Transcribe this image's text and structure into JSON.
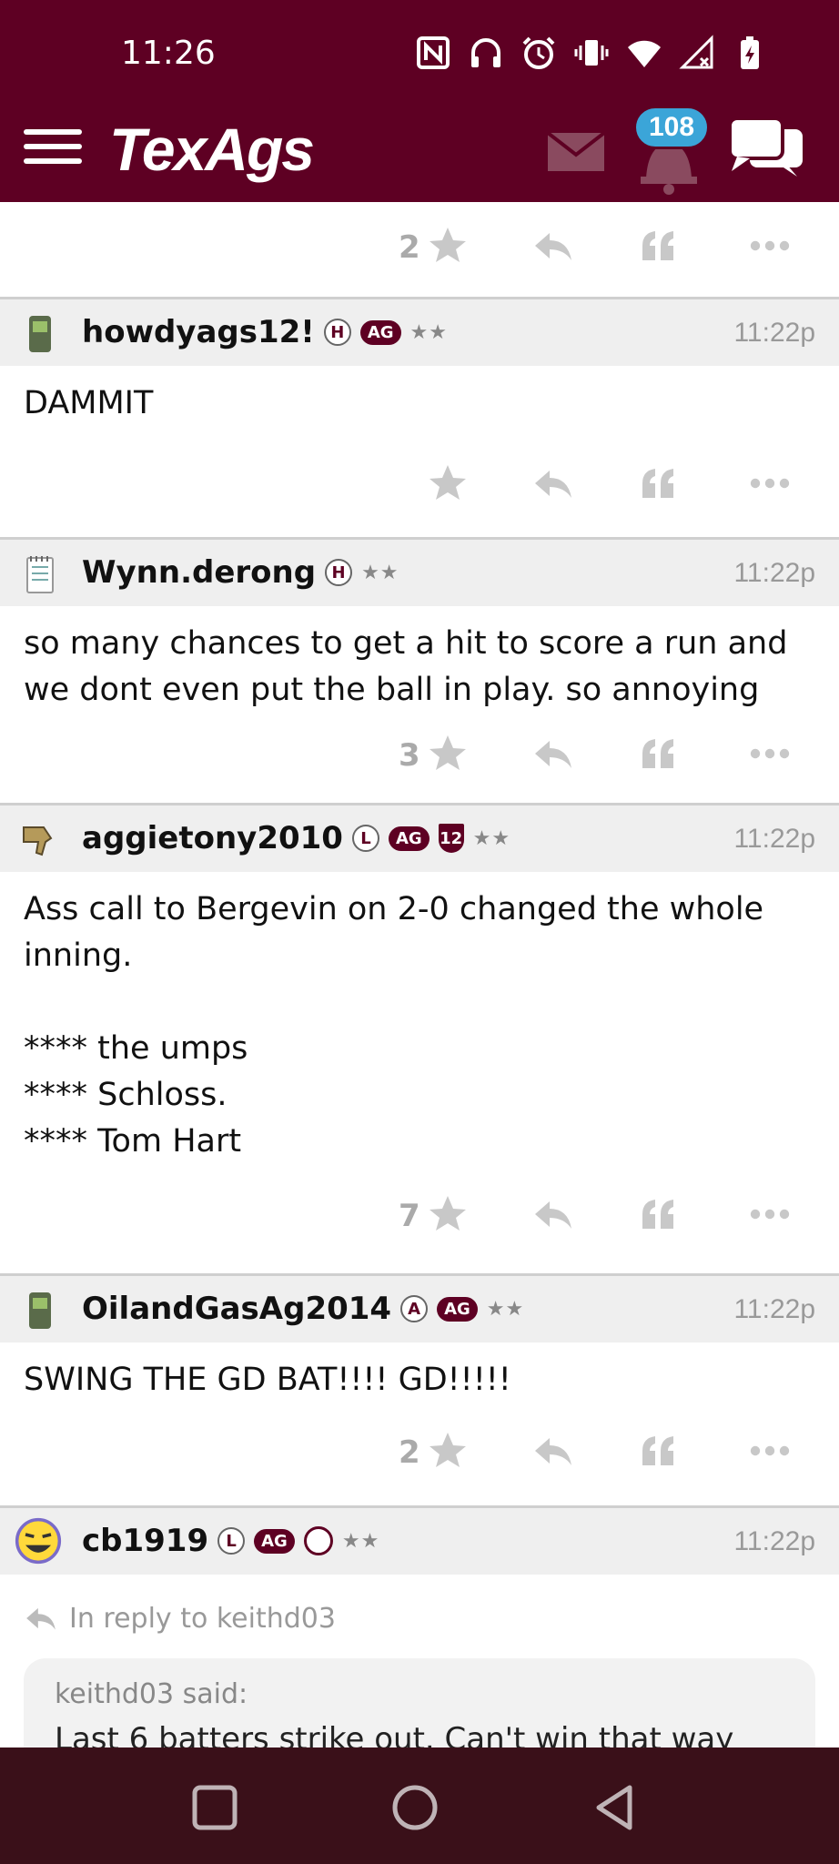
{
  "status_bar": {
    "time": "11:26",
    "icons": [
      "nfc-icon",
      "headphones-icon",
      "alarm-icon",
      "vibrate-icon",
      "wifi-icon",
      "signal-icon",
      "battery-charging-icon"
    ]
  },
  "header": {
    "logo": "TexAgs",
    "notification_count": "108",
    "colors": {
      "primary": "#5e0023",
      "badge": "#3ba5d8"
    }
  },
  "top_partial": {
    "count": "2"
  },
  "posts": [
    {
      "username": "howdyags12!",
      "time": "11:22p",
      "badges": [
        "H",
        "AG"
      ],
      "stars": "★★",
      "avatar": "phone-icon",
      "lines": [
        "DAMMIT"
      ],
      "count": ""
    },
    {
      "username": "Wynn.derong",
      "time": "11:22p",
      "badges": [
        "H"
      ],
      "stars": "★★",
      "avatar": "notepad-icon",
      "lines": [
        "so many chances to get a hit to score a run and",
        "we dont even put the ball in play. so annoying"
      ],
      "count": "3"
    },
    {
      "username": "aggietony2010",
      "time": "11:22p",
      "badges": [
        "L",
        "AG",
        "12"
      ],
      "stars": "★★",
      "avatar": "thumbs-down-icon",
      "lines": [
        "Ass call to Bergevin on 2-0 changed the whole",
        "inning.",
        "",
        "**** the umps",
        "**** Schloss.",
        "**** Tom Hart"
      ],
      "count": "7"
    },
    {
      "username": "OilandGasAg2014",
      "time": "11:22p",
      "badges": [
        "A",
        "AG"
      ],
      "stars": "★★",
      "avatar": "phone-icon",
      "lines": [
        "SWING THE GD BAT!!!! GD!!!!!"
      ],
      "count": "2"
    },
    {
      "username": "cb1919",
      "time": "11:22p",
      "badges": [
        "L",
        "AG"
      ],
      "stars": "★★",
      "avatar": "laughing-emoji-icon",
      "reply_to": "In reply to keithd03",
      "quote_author": "keithd03 said:",
      "quote_text": "Last 6 batters strike out. Can't win that way"
    }
  ]
}
